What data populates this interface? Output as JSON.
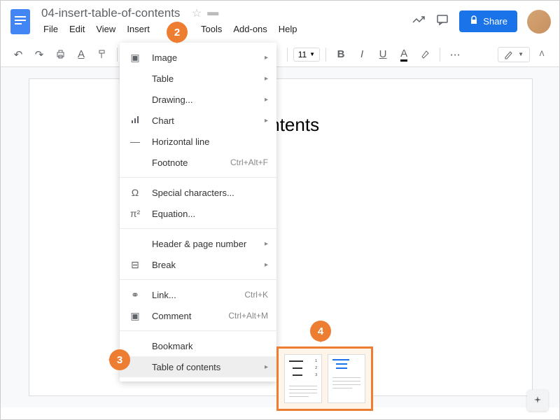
{
  "document": {
    "title": "04-insert-table-of-contents",
    "heading": "Contents"
  },
  "menubar": {
    "file": "File",
    "edit": "Edit",
    "view": "View",
    "insert": "Insert",
    "tools": "Tools",
    "addons": "Add-ons",
    "help": "Help"
  },
  "share": {
    "label": "Share"
  },
  "toolbar": {
    "font_size": "11"
  },
  "insert_menu": {
    "image": "Image",
    "table": "Table",
    "drawing": "Drawing...",
    "chart": "Chart",
    "hline": "Horizontal line",
    "footnote": "Footnote",
    "footnote_sc": "Ctrl+Alt+F",
    "special": "Special characters...",
    "equation": "Equation...",
    "header": "Header & page number",
    "break": "Break",
    "link": "Link...",
    "link_sc": "Ctrl+K",
    "comment": "Comment",
    "comment_sc": "Ctrl+Alt+M",
    "bookmark": "Bookmark",
    "toc": "Table of contents"
  },
  "callouts": {
    "c2": "2",
    "c3": "3",
    "c4": "4"
  }
}
